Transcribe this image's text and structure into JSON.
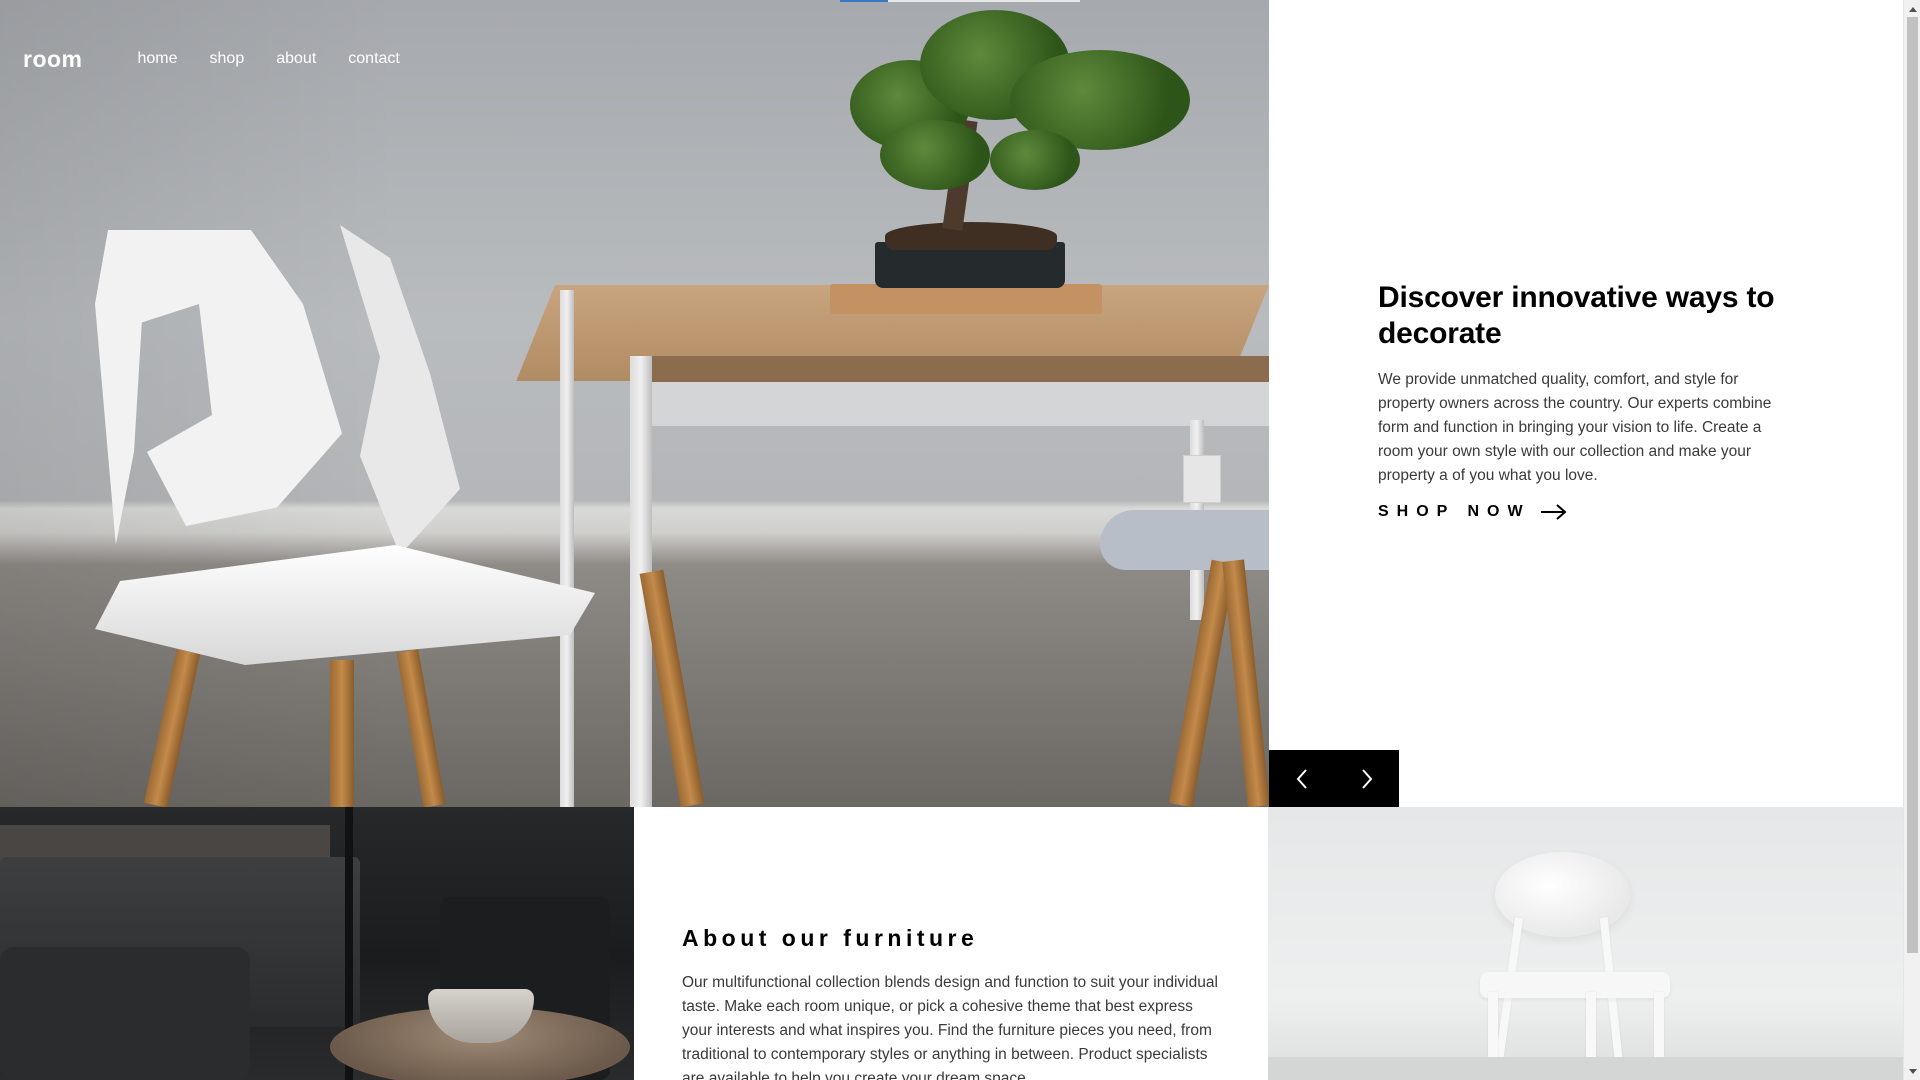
{
  "header": {
    "logo": "room",
    "nav": [
      {
        "label": "home"
      },
      {
        "label": "shop"
      },
      {
        "label": "about"
      },
      {
        "label": "contact"
      }
    ]
  },
  "hero": {
    "title": "Discover innovative ways to decorate",
    "text": "We provide unmatched quality, comfort, and style for property owners across the country. Our experts combine form and function in bringing your vision to life. Create a room your own style with our collection and make your property a of you what you love.",
    "cta": "SHOP NOW",
    "cta_icon": "arrow-right-icon",
    "slider": {
      "prev_icon": "chevron-left-icon",
      "next_icon": "chevron-right-icon"
    },
    "indicator_color": "#3b78c4"
  },
  "about": {
    "title": "About our furniture",
    "text": "Our multifunctional collection blends design and function to suit your individual taste. Make each room unique, or pick a cohesive theme that best express your interests and what inspires you. Find the furniture pieces you need, from traditional to contemporary styles or anything in between. Product specialists are available to help you create your dream space."
  },
  "colors": {
    "text": "#000000",
    "body_text": "#3a3a3a",
    "control_bg": "#000000"
  }
}
